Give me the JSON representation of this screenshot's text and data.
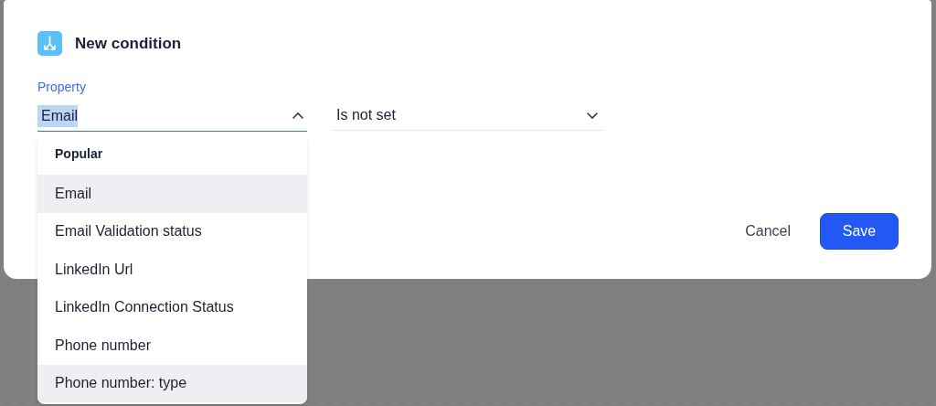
{
  "dialog": {
    "title": "New condition",
    "property": {
      "label": "Property",
      "value": "Email",
      "text_selected": true,
      "open": true
    },
    "operator": {
      "value": "Is not set",
      "open": false
    },
    "dropdown": {
      "group": "Popular",
      "items": [
        {
          "label": "Email",
          "highlighted": true
        },
        {
          "label": "Email Validation status",
          "highlighted": false
        },
        {
          "label": "LinkedIn Url",
          "highlighted": false
        },
        {
          "label": "LinkedIn Connection Status",
          "highlighted": false
        },
        {
          "label": "Phone number",
          "highlighted": false
        },
        {
          "label": "Phone number: type",
          "highlighted": true
        }
      ]
    },
    "buttons": [
      {
        "label": "Cancel",
        "kind": "secondary"
      },
      {
        "label": "Save",
        "kind": "primary"
      }
    ]
  }
}
